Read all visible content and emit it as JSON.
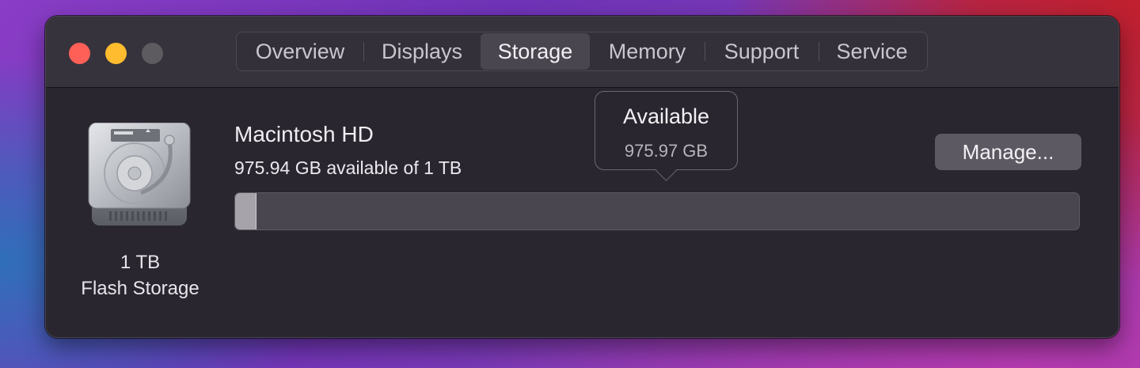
{
  "tabs": [
    {
      "label": "Overview",
      "active": false
    },
    {
      "label": "Displays",
      "active": false
    },
    {
      "label": "Storage",
      "active": true
    },
    {
      "label": "Memory",
      "active": false
    },
    {
      "label": "Support",
      "active": false
    },
    {
      "label": "Service",
      "active": false
    }
  ],
  "device": {
    "icon": "hard-drive-icon",
    "capacity": "1 TB",
    "type": "Flash Storage"
  },
  "volume": {
    "name": "Macintosh HD",
    "availability_text": "975.94 GB available of 1 TB",
    "used_fraction": 0.024
  },
  "manage_button": "Manage...",
  "tooltip": {
    "title": "Available",
    "value": "975.97 GB"
  },
  "colors": {
    "close": "#fe5f57",
    "minimize": "#febc2e",
    "zoom_disabled": "#5d5a60"
  }
}
